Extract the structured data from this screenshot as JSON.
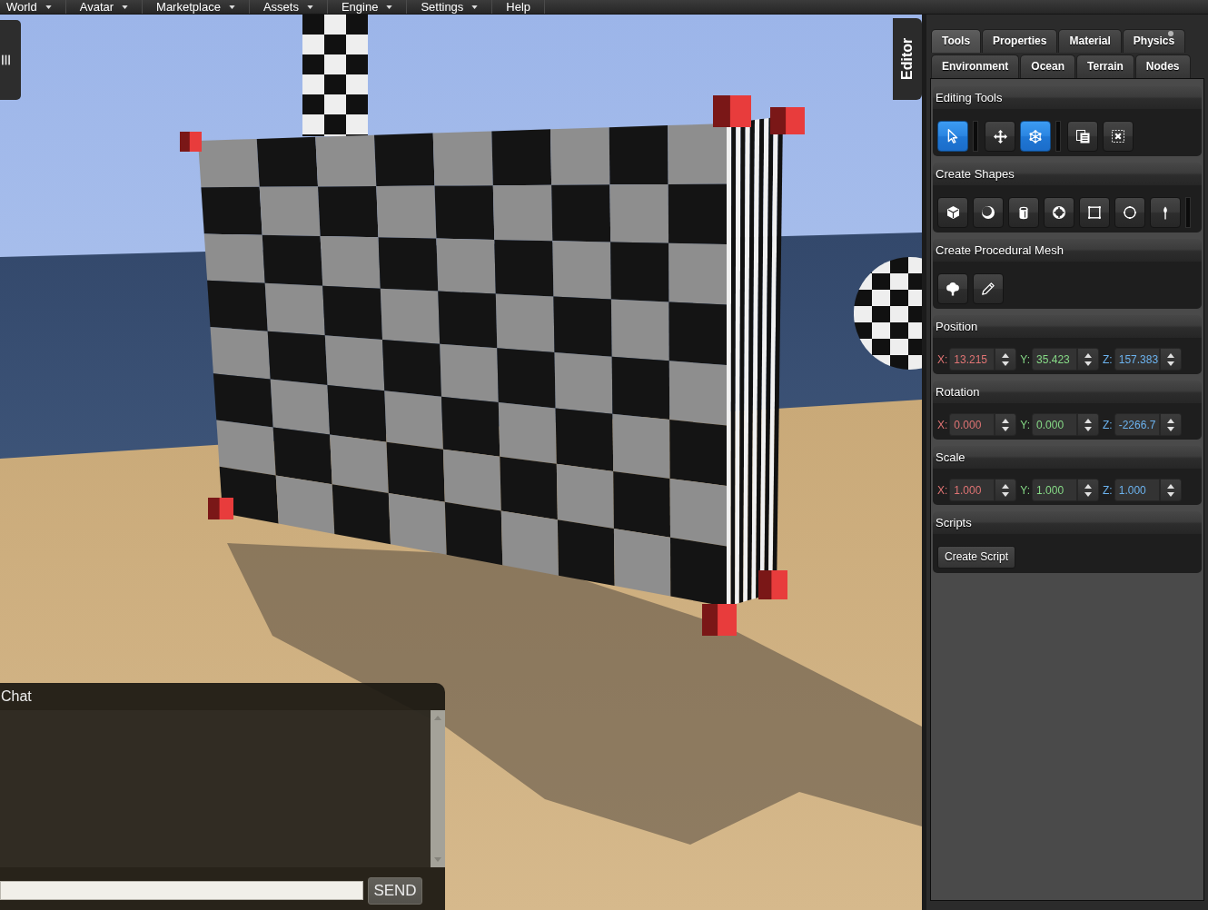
{
  "menu_bar": {
    "items": [
      {
        "label": "World",
        "dropdown": true
      },
      {
        "label": "Avatar",
        "dropdown": true
      },
      {
        "label": "Marketplace",
        "dropdown": true
      },
      {
        "label": "Assets",
        "dropdown": true
      },
      {
        "label": "Engine",
        "dropdown": true
      },
      {
        "label": "Settings",
        "dropdown": true
      },
      {
        "label": "Help",
        "dropdown": false
      }
    ]
  },
  "editor_tab": {
    "label": "Editor"
  },
  "chat": {
    "title": "Chat",
    "send_button": "SEND"
  },
  "editor_panel": {
    "tab_rows": [
      [
        {
          "label": "Tools",
          "selected": true,
          "dot": false
        },
        {
          "label": "Properties",
          "selected": false,
          "dot": false
        },
        {
          "label": "Material",
          "selected": false,
          "dot": false
        },
        {
          "label": "Physics",
          "selected": false,
          "dot": true
        }
      ],
      [
        {
          "label": "Environment",
          "selected": false,
          "dot": false
        },
        {
          "label": "Ocean",
          "selected": false,
          "dot": false
        },
        {
          "label": "Terrain",
          "selected": false,
          "dot": false
        },
        {
          "label": "Nodes",
          "selected": false,
          "dot": false
        }
      ]
    ],
    "sections": [
      {
        "title": "Editing Tools",
        "kind": "tools",
        "groups": [
          [
            {
              "selected": true
            }
          ],
          [
            {
              "selected": false
            },
            {
              "selected": true
            }
          ],
          [
            {
              "selected": false
            },
            {
              "selected": false
            }
          ]
        ]
      },
      {
        "title": "Create Shapes",
        "kind": "shapes",
        "groups": [
          [
            {
              "selected": false
            },
            {
              "selected": false
            },
            {
              "selected": false
            },
            {
              "selected": false
            },
            {
              "selected": false
            },
            {
              "selected": false
            },
            {
              "selected": false
            }
          ]
        ]
      },
      {
        "title": "Create Procedural Mesh",
        "kind": "mesh",
        "groups": [
          [
            {
              "selected": false
            },
            {
              "selected": false
            }
          ]
        ]
      },
      {
        "title": "Position",
        "kind": "vector",
        "fields": [
          {
            "axis": "X:",
            "value": "13.215",
            "color": "#e07474"
          },
          {
            "axis": "Y:",
            "value": "35.423",
            "color": "#86d986"
          },
          {
            "axis": "Z:",
            "value": "157.383",
            "color": "#6cb3ef"
          }
        ]
      },
      {
        "title": "Rotation",
        "kind": "vector",
        "fields": [
          {
            "axis": "X:",
            "value": "0.000",
            "color": "#e07474"
          },
          {
            "axis": "Y:",
            "value": "0.000",
            "color": "#86d986"
          },
          {
            "axis": "Z:",
            "value": "-2266.7",
            "color": "#6cb3ef"
          }
        ]
      },
      {
        "title": "Scale",
        "kind": "vector",
        "fields": [
          {
            "axis": "X:",
            "value": "1.000",
            "color": "#e07474"
          },
          {
            "axis": "Y:",
            "value": "1.000",
            "color": "#86d986"
          },
          {
            "axis": "Z:",
            "value": "1.000",
            "color": "#6cb3ef"
          }
        ]
      },
      {
        "title": "Scripts",
        "kind": "scripts",
        "button": "Create Script"
      }
    ]
  }
}
